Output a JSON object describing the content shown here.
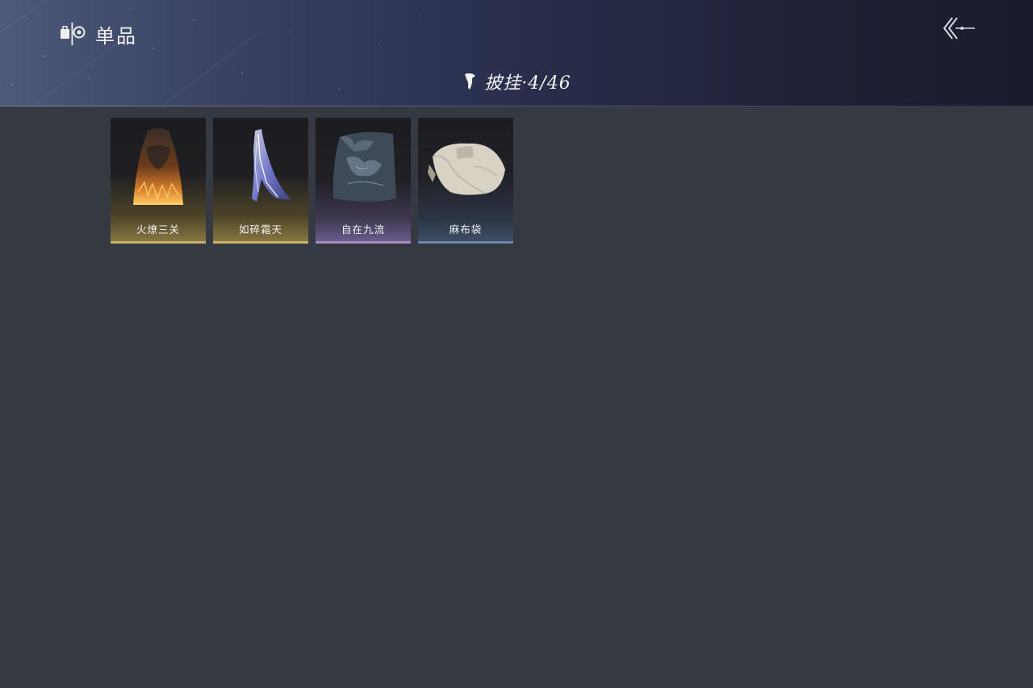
{
  "header": {
    "title": "单品",
    "title_icon": "item-set-icon",
    "back_icon": "back-arrow-icon"
  },
  "category": {
    "icon": "cape-icon",
    "name": "披挂",
    "separator": "·",
    "count": "4/46"
  },
  "items": [
    {
      "name": "火燎三关",
      "rarity_color": "#c8b069",
      "icon": "flame-cape-icon"
    },
    {
      "name": "如碎霜天",
      "rarity_color": "#c8b069",
      "icon": "frost-cape-icon"
    },
    {
      "name": "自在九流",
      "rarity_color": "#a08bc0",
      "icon": "embroidered-cape-icon"
    },
    {
      "name": "麻布袋",
      "rarity_color": "#6c86a8",
      "icon": "sack-icon"
    }
  ],
  "colors": {
    "background": "#353942",
    "header_dark": "#1a1c2c",
    "text": "#f2f2f2"
  }
}
